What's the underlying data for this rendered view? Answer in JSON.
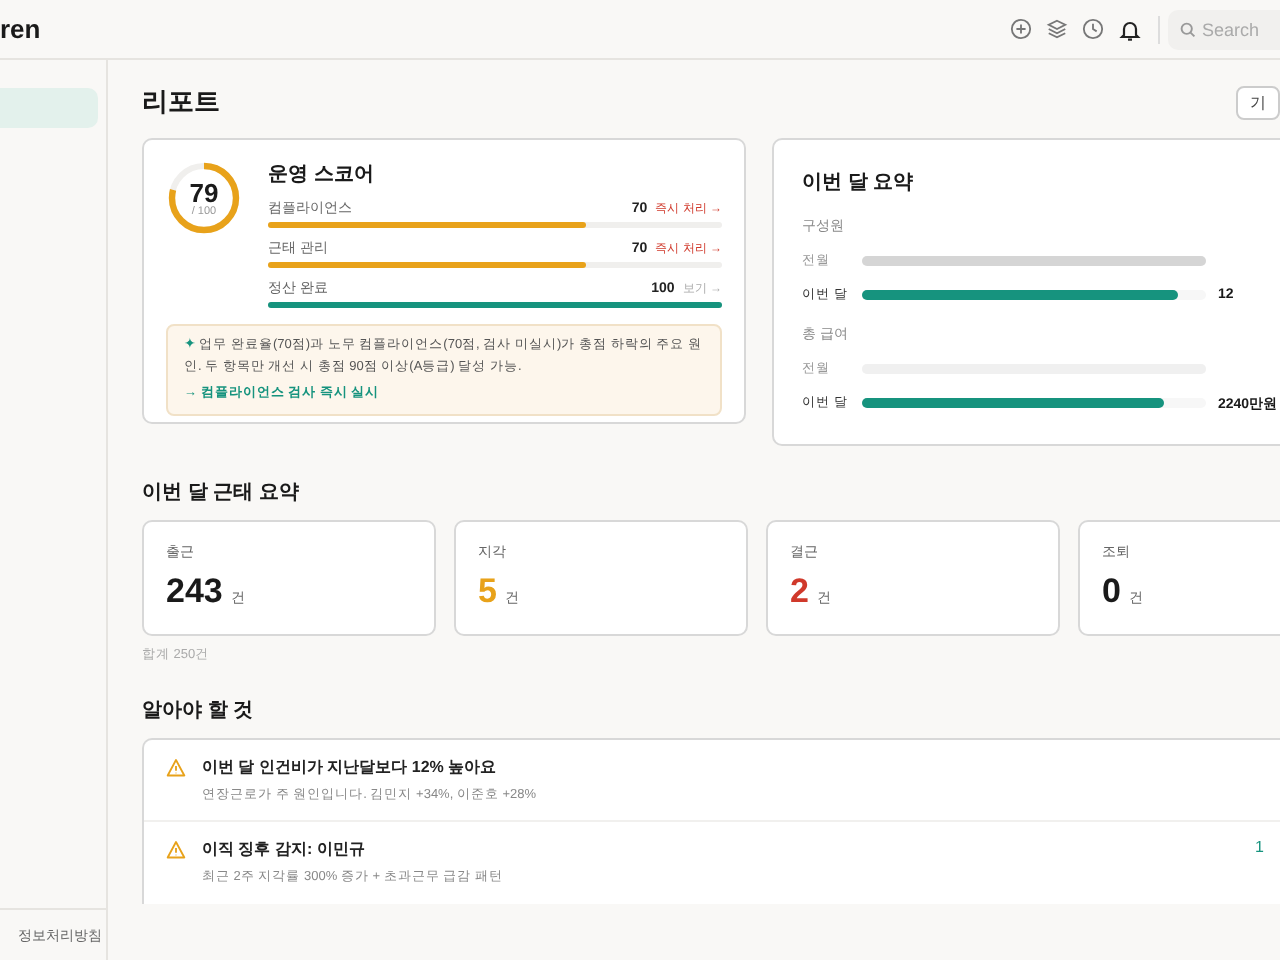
{
  "header": {
    "logo": "ren",
    "search": {
      "placeholder": "Search"
    }
  },
  "sidebar": {
    "items": [
      {
        "selected": true
      }
    ],
    "footer_link": "정보처리방침"
  },
  "page": {
    "title": "리포트",
    "action_button": "기"
  },
  "score_card": {
    "score": "79",
    "max": "/ 100",
    "level": 0.79,
    "title": "운영 스코어",
    "rows": [
      {
        "label": "컴플라이언스",
        "value": "70",
        "action": "즉시 처리 →",
        "kind": "urgent",
        "level": 0.7
      },
      {
        "label": "근태 관리",
        "value": "70",
        "action": "즉시 처리 →",
        "kind": "urgent",
        "level": 0.7
      },
      {
        "label": "정산 완료",
        "value": "100",
        "action": "보기 →",
        "kind": "ok",
        "level": 1.0
      }
    ],
    "note": {
      "icon": "✦",
      "text": "업무 완료율(70점)과 노무 컴플라이언스(70점, 검사 미실시)가 총점 하락의 주요 원인. 두 항목만 개선 시 총점 90점 이상(A등급) 달성 가능.",
      "link": "→ 컴플라이언스 검사 즉시 실시"
    }
  },
  "summary_card": {
    "title": "이번 달 요약",
    "groups": [
      {
        "label": "구성원",
        "rows": [
          {
            "label": "전월",
            "kind": "previous",
            "level": 1.0
          },
          {
            "label": "이번 달",
            "kind": "current",
            "level": 0.92,
            "value": "12"
          }
        ]
      },
      {
        "label": "총 급여",
        "rows": [
          {
            "label": "전월",
            "kind": "previous_light",
            "level": 1.0
          },
          {
            "label": "이번 달",
            "kind": "current",
            "level": 0.88,
            "value": "2240만원"
          }
        ]
      }
    ]
  },
  "attendance": {
    "title": "이번 달 근태 요약",
    "cards": [
      {
        "label": "출근",
        "value": "243",
        "unit": "건",
        "color": "#1a1a1a"
      },
      {
        "label": "지각",
        "value": "5",
        "unit": "건",
        "color": "#e8a21a"
      },
      {
        "label": "결근",
        "value": "2",
        "unit": "건",
        "color": "#d0392b"
      },
      {
        "label": "조퇴",
        "value": "0",
        "unit": "건",
        "color": "#1a1a1a"
      }
    ],
    "total": "합계 250건"
  },
  "alerts": {
    "title": "알아야 할 것",
    "items": [
      {
        "title": "이번 달 인건비가 지난달보다 12% 높아요",
        "detail": "연장근로가 주 원인입니다. 김민지 +34%, 이준호 +28%"
      },
      {
        "title": "이직 징후 감지: 이민규",
        "detail": "최근 2주 지각률 300% 증가 + 초과근무 급감 패턴",
        "trailing": "1"
      }
    ]
  }
}
